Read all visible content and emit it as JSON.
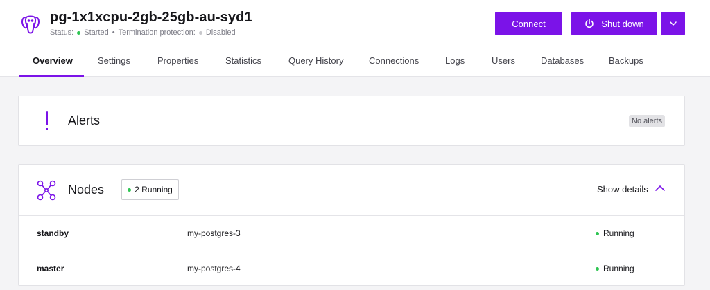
{
  "header": {
    "title": "pg-1x1xcpu-2gb-25gb-au-syd1",
    "status_label": "Status:",
    "status_value": "Started",
    "separator": "•",
    "termination_label": "Termination protection:",
    "termination_value": "Disabled",
    "logo_icon": "postgres-elephant-icon"
  },
  "actions": {
    "connect_label": "Connect",
    "shutdown_label": "Shut down",
    "shutdown_icon": "power-icon",
    "more_icon": "chevron-down-icon"
  },
  "tabs": [
    {
      "label": "Overview",
      "active": true
    },
    {
      "label": "Settings",
      "active": false
    },
    {
      "label": "Properties",
      "active": false
    },
    {
      "label": "Statistics",
      "active": false
    },
    {
      "label": "Query History",
      "active": false
    },
    {
      "label": "Connections",
      "active": false
    },
    {
      "label": "Logs",
      "active": false
    },
    {
      "label": "Users",
      "active": false
    },
    {
      "label": "Databases",
      "active": false
    },
    {
      "label": "Backups",
      "active": false
    }
  ],
  "alerts": {
    "title": "Alerts",
    "icon": "exclamation-icon",
    "badge": "No alerts"
  },
  "nodes": {
    "title": "Nodes",
    "icon": "nodes-network-icon",
    "running_badge": "2 Running",
    "show_details": "Show details",
    "rows": [
      {
        "role": "standby",
        "name": "my-postgres-3",
        "state": "Running"
      },
      {
        "role": "master",
        "name": "my-postgres-4",
        "state": "Running"
      }
    ]
  },
  "colors": {
    "accent": "#7b13e8",
    "running": "#2fc553",
    "disabled": "#c8c8cc"
  }
}
